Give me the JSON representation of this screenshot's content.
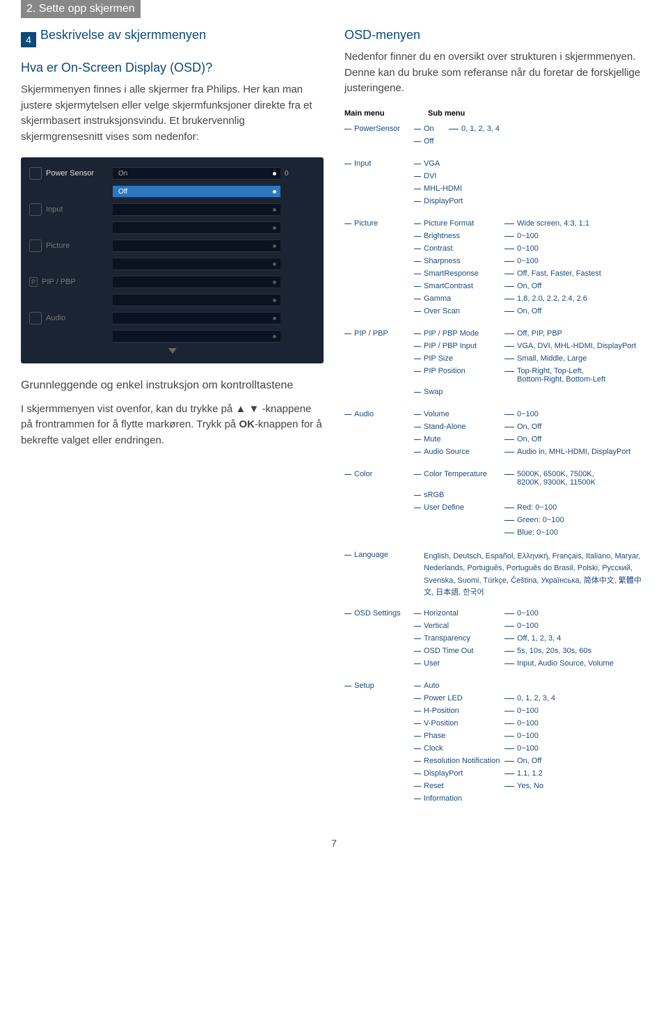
{
  "header": {
    "section": "2. Sette opp skjermen"
  },
  "step": {
    "num": "4",
    "title": "Beskrivelse av skjermmenyen"
  },
  "left": {
    "sub1": "Hva er On-Screen Display (OSD)?",
    "para1": "Skjermmenyen finnes i alle skjermer fra Philips. Her kan man justere skjermytelsen eller velge skjermfunksjoner direkte fra et skjermbasert instruksjonsvindu. Et brukervennlig skjermgrensesnitt vises som nedenfor:",
    "osd": {
      "items": [
        "Power Sensor",
        "Input",
        "Picture",
        "PIP / PBP",
        "Audio"
      ],
      "on": "On",
      "off": "Off",
      "zero": "0"
    },
    "sub2": "Grunnleggende og enkel instruksjon om kontrolltastene",
    "para2a": "I skjermmenyen vist ovenfor, kan du trykke på ▲ ▼ -knappene på frontrammen for å flytte markøren. Trykk på ",
    "para2b": "OK",
    "para2c": "-knappen for å bekrefte valget eller endringen."
  },
  "right": {
    "title": "OSD-menyen",
    "para": "Nedenfor finner du en oversikt over strukturen i skjermmenyen. Denne kan du bruke som referanse når du foretar de forskjellige justeringene.",
    "treeHeader": {
      "main": "Main menu",
      "sub": "Sub menu"
    }
  },
  "tree": {
    "ps": {
      "label": "PowerSensor",
      "on": "On",
      "off": "Off",
      "vals": "0, 1, 2, 3, 4"
    },
    "input": {
      "label": "Input",
      "items": [
        "VGA",
        "DVI",
        "MHL-HDMI",
        "DisplayPort"
      ]
    },
    "picture": {
      "label": "Picture",
      "rows": [
        {
          "s": "Picture Format",
          "v": "Wide screen, 4:3, 1:1"
        },
        {
          "s": "Brightness",
          "v": "0~100"
        },
        {
          "s": "Contrast",
          "v": "0~100"
        },
        {
          "s": "Sharpness",
          "v": "0~100"
        },
        {
          "s": "SmartResponse",
          "v": "Off, Fast, Faster, Fastest"
        },
        {
          "s": "SmartContrast",
          "v": "On, Off"
        },
        {
          "s": "Gamma",
          "v": "1.8, 2.0, 2.2, 2.4, 2.6"
        },
        {
          "s": "Over Scan",
          "v": "On, Off"
        }
      ]
    },
    "pip": {
      "label": "PIP / PBP",
      "rows": [
        {
          "s": "PIP / PBP Mode",
          "v": "Off, PIP, PBP"
        },
        {
          "s": "PIP / PBP Input",
          "v": "VGA, DVI, MHL-HDMI, DisplayPort"
        },
        {
          "s": "PIP Size",
          "v": "Small, Middle, Large"
        },
        {
          "s": "PIP Position",
          "v": "Top-Right, Top-Left,\nBottom-Right, Bottom-Left"
        },
        {
          "s": "Swap",
          "v": ""
        }
      ]
    },
    "audio": {
      "label": "Audio",
      "rows": [
        {
          "s": "Volume",
          "v": "0~100"
        },
        {
          "s": "Stand-Alone",
          "v": "On, Off"
        },
        {
          "s": "Mute",
          "v": "On, Off"
        },
        {
          "s": "Audio Source",
          "v": "Audio in, MHL-HDMI, DisplayPort"
        }
      ]
    },
    "color": {
      "label": "Color",
      "rows": [
        {
          "s": "Color Temperature",
          "v": "5000K, 6500K, 7500K,\n8200K, 9300K, 11500K"
        },
        {
          "s": "sRGB",
          "v": ""
        },
        {
          "s": "User Define",
          "v": "Red: 0~100"
        }
      ],
      "extra": [
        "Green: 0~100",
        "Blue: 0~100"
      ]
    },
    "lang": {
      "label": "Language",
      "text": "English, Deutsch, Español, Ελληνική, Français, Italiano, Maryar, Nederlands, Português, Português do Brasil, Polski, Русский, Svenska, Suomi, Türkçe, Čeština, Українська, 简体中文, 繁體中文, 日本語, 한국어"
    },
    "osd": {
      "label": "OSD Settings",
      "rows": [
        {
          "s": "Horizontal",
          "v": "0~100"
        },
        {
          "s": "Vertical",
          "v": "0~100"
        },
        {
          "s": "Transparency",
          "v": "Off, 1, 2, 3, 4"
        },
        {
          "s": "OSD Time Out",
          "v": "5s, 10s, 20s, 30s, 60s"
        },
        {
          "s": "User",
          "v": "Input, Audio Source, Volume"
        }
      ]
    },
    "setup": {
      "label": "Setup",
      "rows": [
        {
          "s": "Auto",
          "v": ""
        },
        {
          "s": "Power LED",
          "v": "0, 1, 2, 3, 4"
        },
        {
          "s": "H-Position",
          "v": "0~100"
        },
        {
          "s": "V-Position",
          "v": "0~100"
        },
        {
          "s": "Phase",
          "v": "0~100"
        },
        {
          "s": "Clock",
          "v": "0~100"
        },
        {
          "s": "Resolution Notification",
          "v": "On, Off"
        },
        {
          "s": "DisplayPort",
          "v": "1.1, 1.2"
        },
        {
          "s": "Reset",
          "v": "Yes, No"
        },
        {
          "s": "Information",
          "v": ""
        }
      ]
    }
  },
  "pagenum": "7"
}
